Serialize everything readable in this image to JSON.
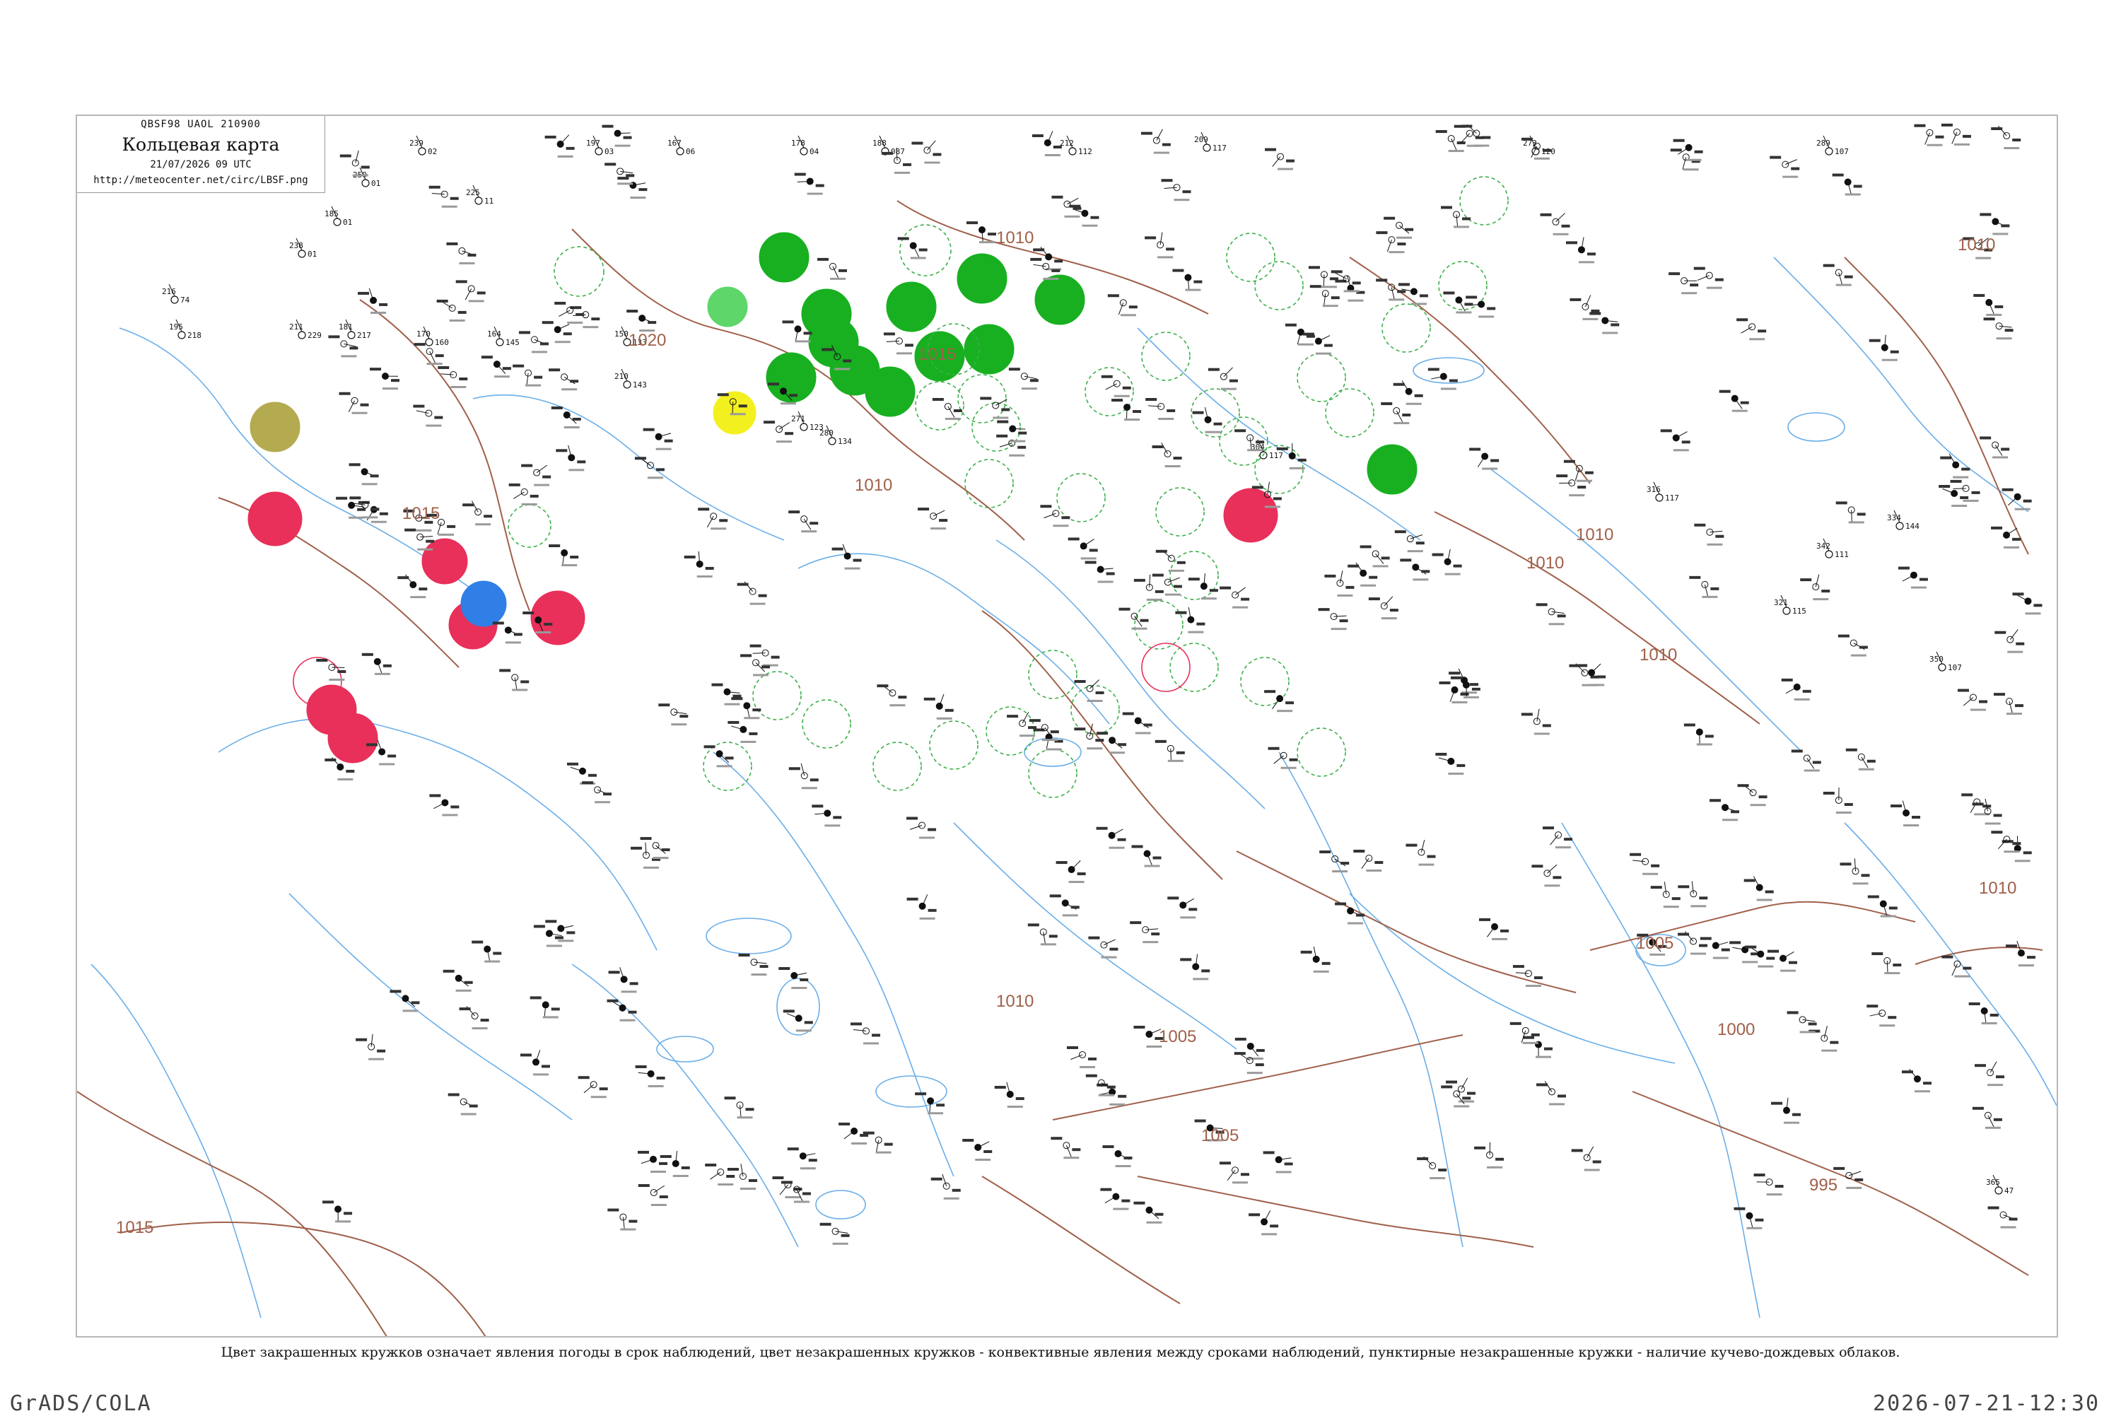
{
  "header": {
    "code": "QBSF98  UAOL  210900",
    "title": "Кольцевая карта",
    "time": "21/07/2026 09 UTC",
    "url": "http://meteocenter.net/circ/LBSF.png"
  },
  "legend": "Цвет закрашенных кружков означает явления погоды в срок наблюдений, цвет незакрашенных кружков - конвективные явления между сроками наблюдений, пунктирные незакрашенные кружки - наличие кучево-дождевых облаков.",
  "footer": {
    "left": "GrADS/COLA",
    "right": "2026-07-21-12:30"
  },
  "colors": {
    "isobar": "#a0604a",
    "river": "#6aaee8",
    "rain_green": "#18b020",
    "thunder_red": "#e8305a",
    "shower_blue": "#2f7fe6",
    "fog_yellow": "#f3f020",
    "haze_olive": "#b4aa50",
    "light_green": "#5ed66a",
    "cb_dashed": "#3cb04a"
  },
  "isobar_labels": [
    {
      "text": "1010"
    },
    {
      "text": "1015"
    },
    {
      "text": "1015"
    },
    {
      "text": "1020"
    },
    {
      "text": "1010"
    },
    {
      "text": "1010"
    },
    {
      "text": "1010"
    },
    {
      "text": "1010"
    },
    {
      "text": "1010"
    },
    {
      "text": "1005"
    },
    {
      "text": "1005"
    },
    {
      "text": "1000"
    },
    {
      "text": "1010"
    },
    {
      "text": "1005"
    },
    {
      "text": "995"
    },
    {
      "text": "1015"
    },
    {
      "text": "1010"
    }
  ],
  "stations": [
    {
      "t": "239",
      "p": "02"
    },
    {
      "t": "197",
      "p": "03"
    },
    {
      "t": "167",
      "p": "06"
    },
    {
      "t": "178",
      "p": "04"
    },
    {
      "t": "188",
      "p": "087"
    },
    {
      "t": "212",
      "p": "112"
    },
    {
      "t": "209",
      "p": "117"
    },
    {
      "t": "273",
      "p": "120"
    },
    {
      "t": "289",
      "p": "107"
    },
    {
      "t": "250",
      "p": "01"
    },
    {
      "t": "225",
      "p": "11"
    },
    {
      "t": "185",
      "p": "01"
    },
    {
      "t": "238",
      "p": "01"
    },
    {
      "t": "216",
      "p": "74"
    },
    {
      "t": "195",
      "p": "218"
    },
    {
      "t": "211",
      "p": "229"
    },
    {
      "t": "181",
      "p": "217"
    },
    {
      "t": "170",
      "p": "160"
    },
    {
      "t": "164",
      "p": "145"
    },
    {
      "t": "150",
      "p": "133"
    },
    {
      "t": "210",
      "p": "143"
    },
    {
      "t": "271",
      "p": "123"
    },
    {
      "t": "280",
      "p": "134"
    },
    {
      "t": "304",
      "p": "117"
    },
    {
      "t": "316",
      "p": "117"
    },
    {
      "t": "321",
      "p": "115"
    },
    {
      "t": "342",
      "p": "111"
    },
    {
      "t": "334",
      "p": "144"
    },
    {
      "t": "350",
      "p": "107"
    },
    {
      "t": "365",
      "p": "47"
    }
  ]
}
